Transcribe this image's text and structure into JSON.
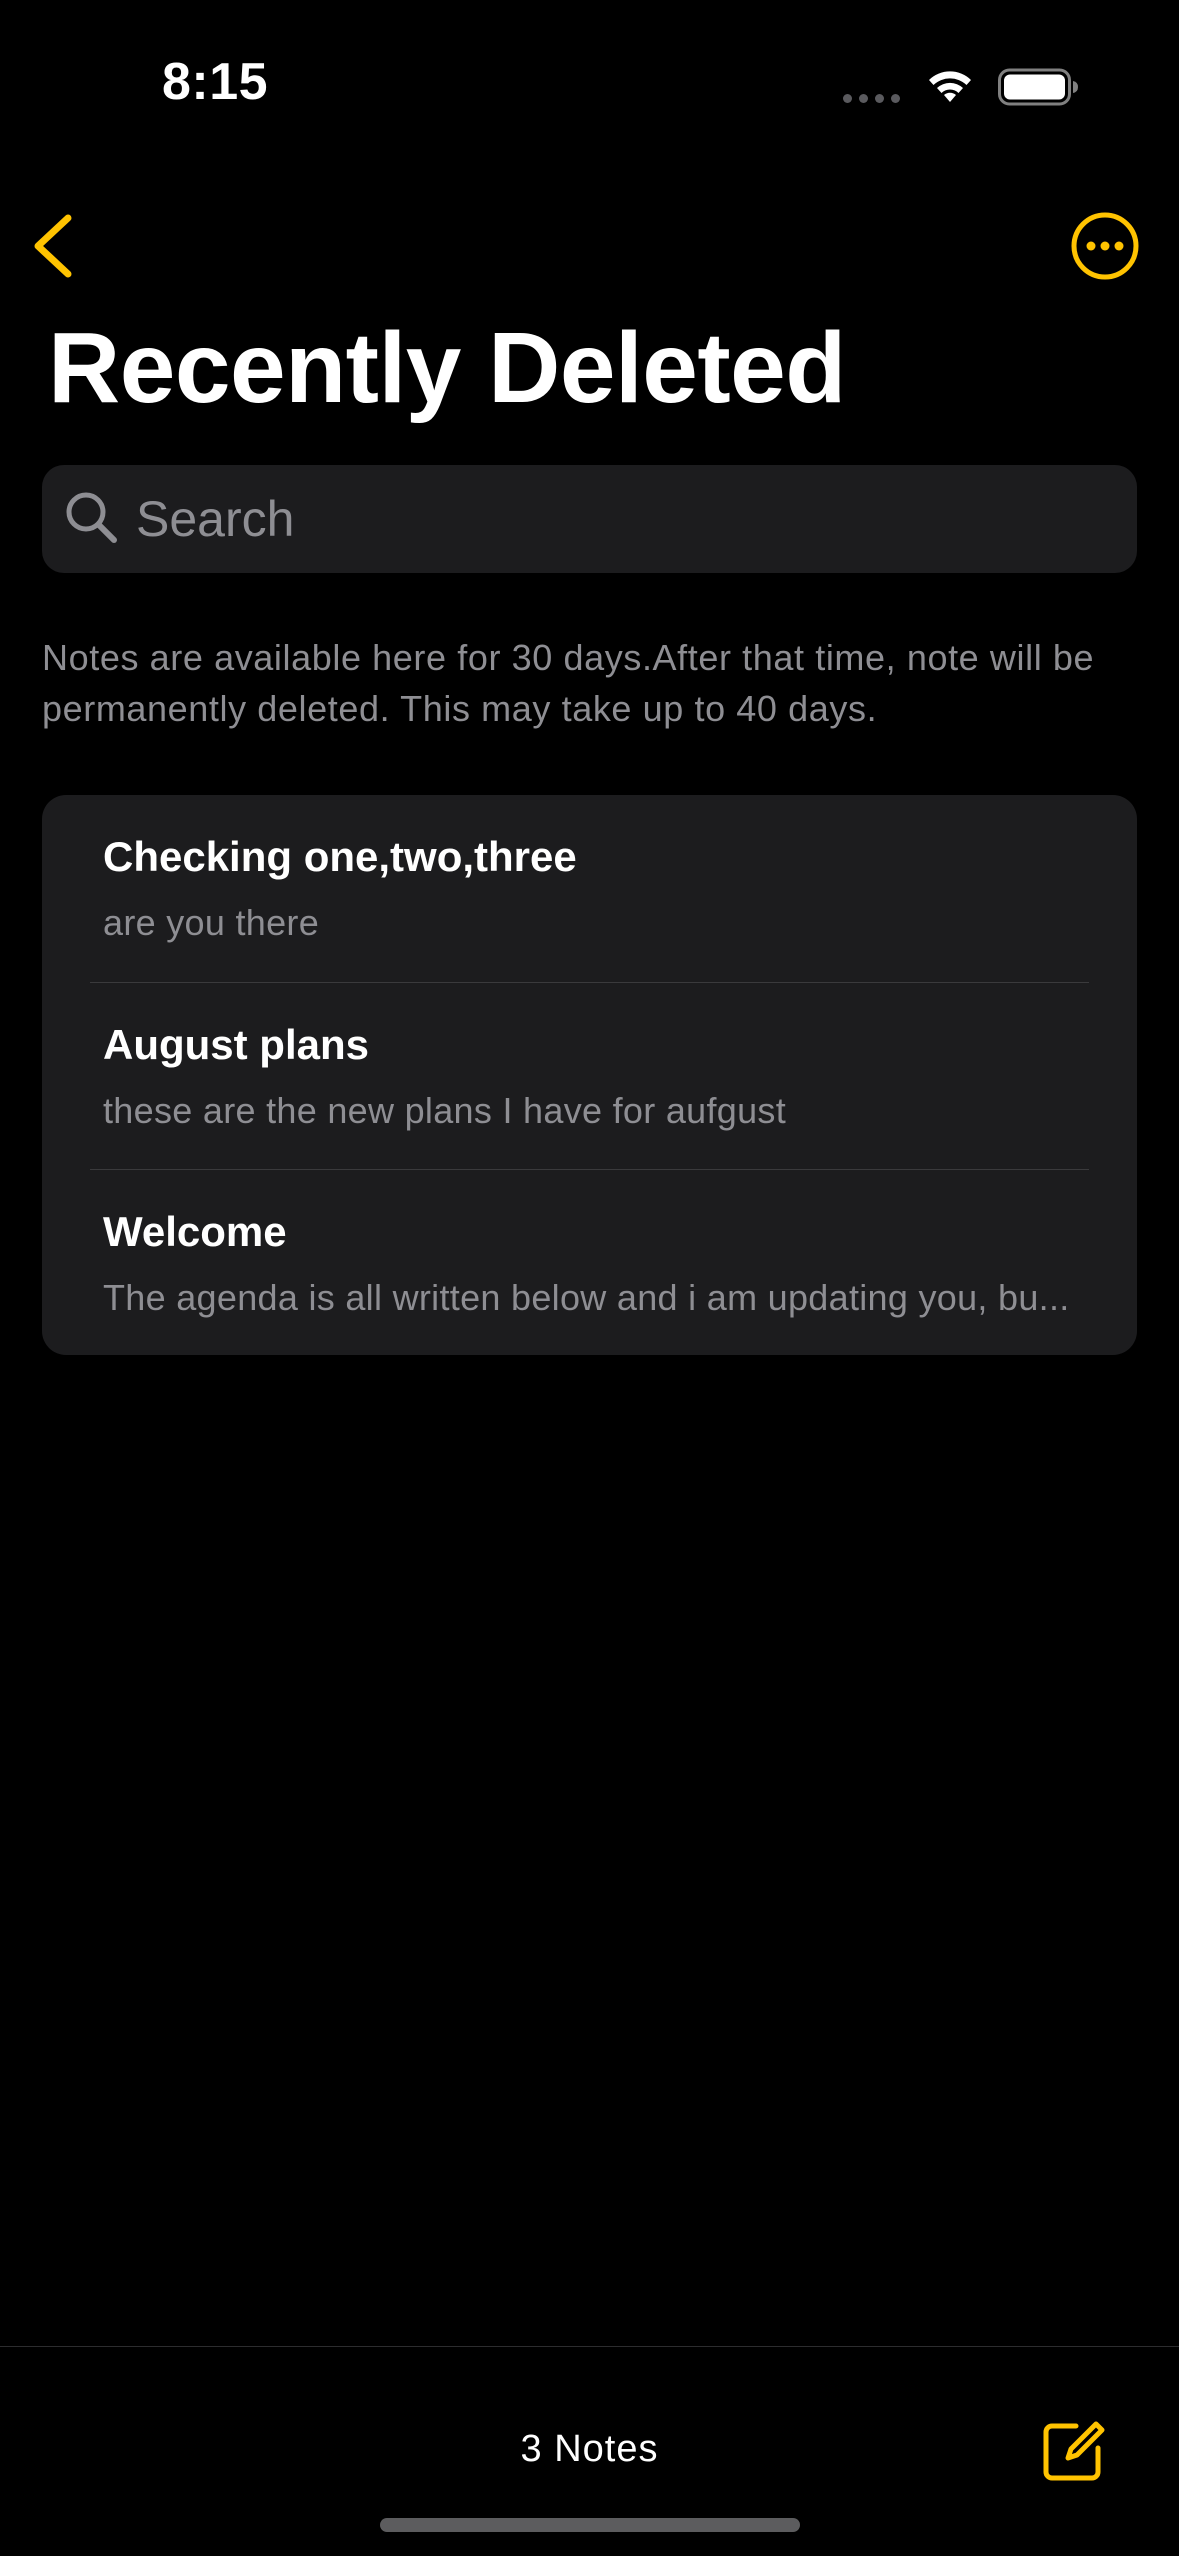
{
  "status_bar": {
    "time": "8:15"
  },
  "nav": {
    "back_icon": "chevron-left-icon",
    "more_icon": "ellipsis-circle-icon",
    "accent_color": "#FFC300"
  },
  "page": {
    "title": "Recently Deleted"
  },
  "search": {
    "placeholder": "Search",
    "value": ""
  },
  "info_text": "Notes are available here for 30 days.After that time, note will be permanently deleted. This may take up to 40 days.",
  "notes": [
    {
      "title": "Checking one,two,three",
      "snippet": "are you there"
    },
    {
      "title": "August plans",
      "snippet": "these are the new plans I have for aufgust"
    },
    {
      "title": "Welcome",
      "snippet": "The agenda is all written below and i am updating you, bu..."
    }
  ],
  "toolbar": {
    "count_label": "3 Notes",
    "compose_icon": "compose-icon"
  }
}
